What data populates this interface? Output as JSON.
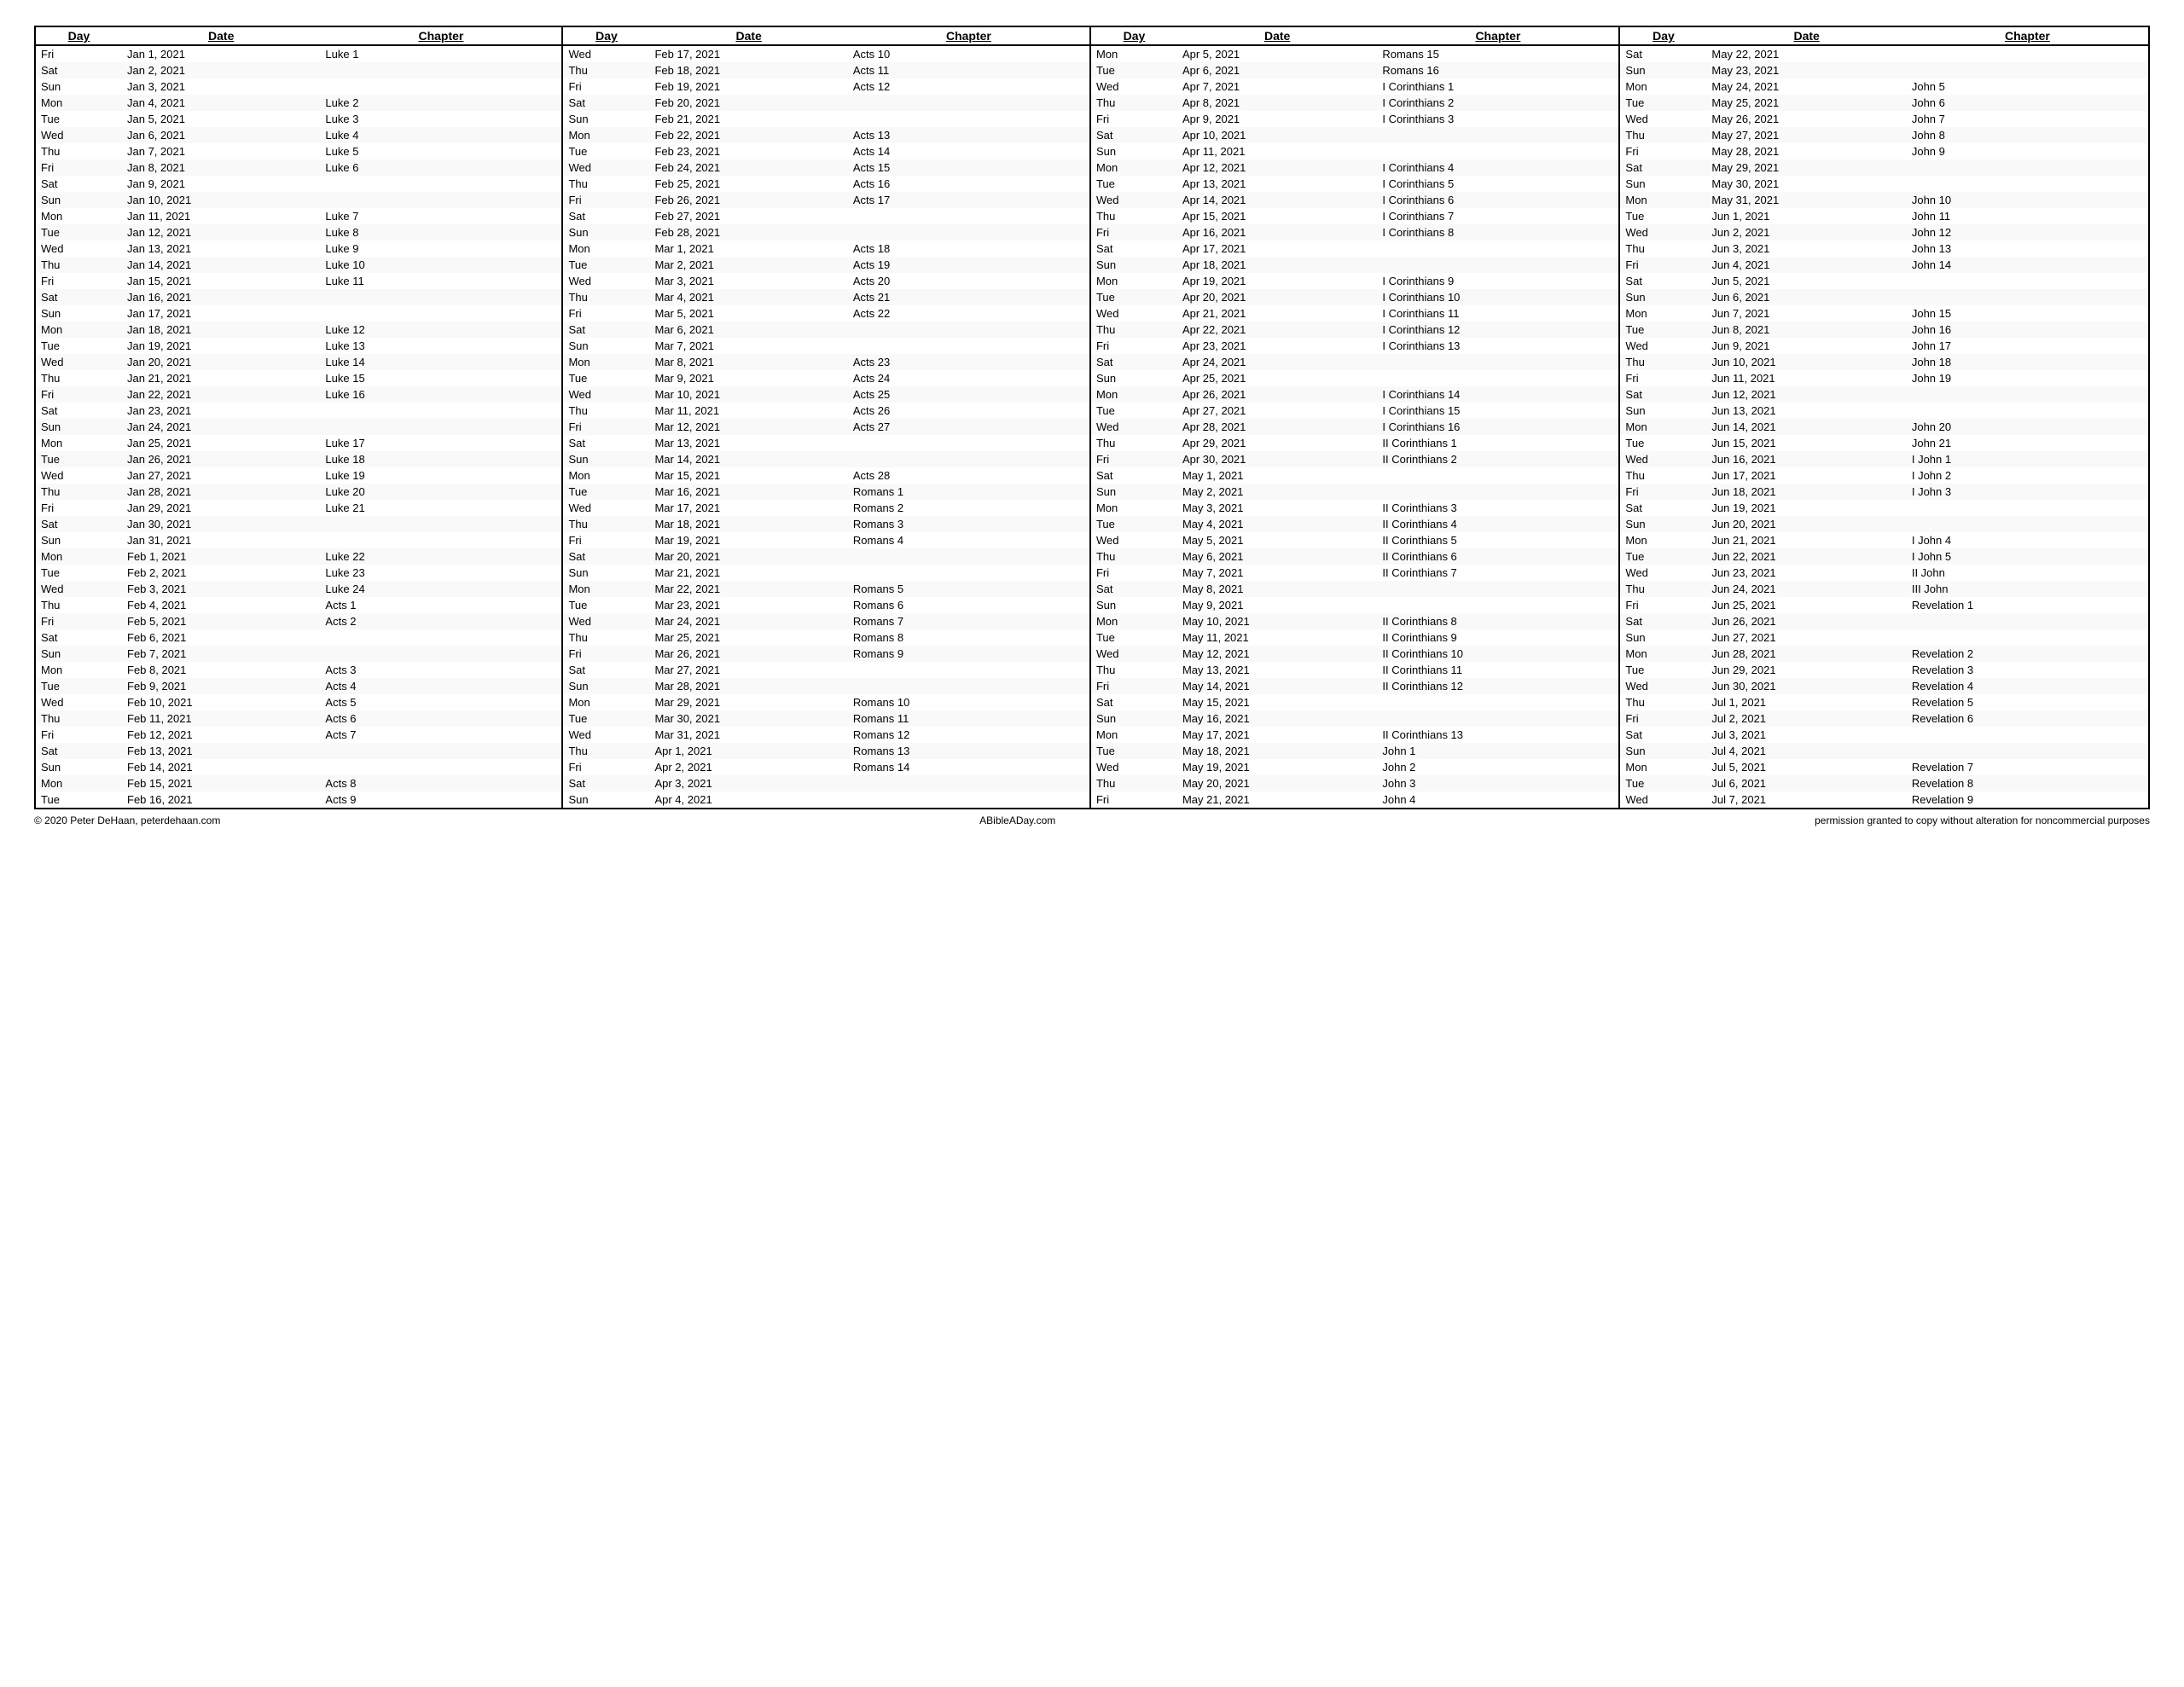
{
  "footer": {
    "copyright": "© 2020 Peter DeHaan, peterdehaan.com",
    "center": "ABibleADay.com",
    "right": "permission granted to copy without alteration for noncommercial purposes"
  },
  "columns": [
    "Day",
    "Date",
    "Chapter"
  ],
  "rows": [
    [
      "Fri",
      "Jan 1, 2021",
      "Luke 1",
      "Wed",
      "Feb 17, 2021",
      "Acts 10",
      "Mon",
      "Apr 5, 2021",
      "Romans 15",
      "Sat",
      "May 22, 2021",
      ""
    ],
    [
      "Sat",
      "Jan 2, 2021",
      "",
      "Thu",
      "Feb 18, 2021",
      "Acts 11",
      "Tue",
      "Apr 6, 2021",
      "Romans 16",
      "Sun",
      "May 23, 2021",
      ""
    ],
    [
      "Sun",
      "Jan 3, 2021",
      "",
      "Fri",
      "Feb 19, 2021",
      "Acts 12",
      "Wed",
      "Apr 7, 2021",
      "I Corinthians 1",
      "Mon",
      "May 24, 2021",
      "John 5"
    ],
    [
      "Mon",
      "Jan 4, 2021",
      "Luke 2",
      "Sat",
      "Feb 20, 2021",
      "",
      "Thu",
      "Apr 8, 2021",
      "I Corinthians 2",
      "Tue",
      "May 25, 2021",
      "John 6"
    ],
    [
      "Tue",
      "Jan 5, 2021",
      "Luke 3",
      "Sun",
      "Feb 21, 2021",
      "",
      "Fri",
      "Apr 9, 2021",
      "I Corinthians 3",
      "Wed",
      "May 26, 2021",
      "John 7"
    ],
    [
      "Wed",
      "Jan 6, 2021",
      "Luke 4",
      "Mon",
      "Feb 22, 2021",
      "Acts 13",
      "Sat",
      "Apr 10, 2021",
      "",
      "Thu",
      "May 27, 2021",
      "John 8"
    ],
    [
      "Thu",
      "Jan 7, 2021",
      "Luke 5",
      "Tue",
      "Feb 23, 2021",
      "Acts 14",
      "Sun",
      "Apr 11, 2021",
      "",
      "Fri",
      "May 28, 2021",
      "John 9"
    ],
    [
      "Fri",
      "Jan 8, 2021",
      "Luke 6",
      "Wed",
      "Feb 24, 2021",
      "Acts 15",
      "Mon",
      "Apr 12, 2021",
      "I Corinthians 4",
      "Sat",
      "May 29, 2021",
      ""
    ],
    [
      "Sat",
      "Jan 9, 2021",
      "",
      "Thu",
      "Feb 25, 2021",
      "Acts 16",
      "Tue",
      "Apr 13, 2021",
      "I Corinthians 5",
      "Sun",
      "May 30, 2021",
      ""
    ],
    [
      "Sun",
      "Jan 10, 2021",
      "",
      "Fri",
      "Feb 26, 2021",
      "Acts 17",
      "Wed",
      "Apr 14, 2021",
      "I Corinthians 6",
      "Mon",
      "May 31, 2021",
      "John 10"
    ],
    [
      "Mon",
      "Jan 11, 2021",
      "Luke 7",
      "Sat",
      "Feb 27, 2021",
      "",
      "Thu",
      "Apr 15, 2021",
      "I Corinthians 7",
      "Tue",
      "Jun 1, 2021",
      "John 11"
    ],
    [
      "Tue",
      "Jan 12, 2021",
      "Luke 8",
      "Sun",
      "Feb 28, 2021",
      "",
      "Fri",
      "Apr 16, 2021",
      "I Corinthians 8",
      "Wed",
      "Jun 2, 2021",
      "John 12"
    ],
    [
      "Wed",
      "Jan 13, 2021",
      "Luke 9",
      "Mon",
      "Mar 1, 2021",
      "Acts 18",
      "Sat",
      "Apr 17, 2021",
      "",
      "Thu",
      "Jun 3, 2021",
      "John 13"
    ],
    [
      "Thu",
      "Jan 14, 2021",
      "Luke 10",
      "Tue",
      "Mar 2, 2021",
      "Acts 19",
      "Sun",
      "Apr 18, 2021",
      "",
      "Fri",
      "Jun 4, 2021",
      "John 14"
    ],
    [
      "Fri",
      "Jan 15, 2021",
      "Luke 11",
      "Wed",
      "Mar 3, 2021",
      "Acts 20",
      "Mon",
      "Apr 19, 2021",
      "I Corinthians 9",
      "Sat",
      "Jun 5, 2021",
      ""
    ],
    [
      "Sat",
      "Jan 16, 2021",
      "",
      "Thu",
      "Mar 4, 2021",
      "Acts 21",
      "Tue",
      "Apr 20, 2021",
      "I Corinthians 10",
      "Sun",
      "Jun 6, 2021",
      ""
    ],
    [
      "Sun",
      "Jan 17, 2021",
      "",
      "Fri",
      "Mar 5, 2021",
      "Acts 22",
      "Wed",
      "Apr 21, 2021",
      "I Corinthians 11",
      "Mon",
      "Jun 7, 2021",
      "John 15"
    ],
    [
      "Mon",
      "Jan 18, 2021",
      "Luke 12",
      "Sat",
      "Mar 6, 2021",
      "",
      "Thu",
      "Apr 22, 2021",
      "I Corinthians 12",
      "Tue",
      "Jun 8, 2021",
      "John 16"
    ],
    [
      "Tue",
      "Jan 19, 2021",
      "Luke 13",
      "Sun",
      "Mar 7, 2021",
      "",
      "Fri",
      "Apr 23, 2021",
      "I Corinthians 13",
      "Wed",
      "Jun 9, 2021",
      "John 17"
    ],
    [
      "Wed",
      "Jan 20, 2021",
      "Luke 14",
      "Mon",
      "Mar 8, 2021",
      "Acts 23",
      "Sat",
      "Apr 24, 2021",
      "",
      "Thu",
      "Jun 10, 2021",
      "John 18"
    ],
    [
      "Thu",
      "Jan 21, 2021",
      "Luke 15",
      "Tue",
      "Mar 9, 2021",
      "Acts 24",
      "Sun",
      "Apr 25, 2021",
      "",
      "Fri",
      "Jun 11, 2021",
      "John 19"
    ],
    [
      "Fri",
      "Jan 22, 2021",
      "Luke 16",
      "Wed",
      "Mar 10, 2021",
      "Acts 25",
      "Mon",
      "Apr 26, 2021",
      "I Corinthians 14",
      "Sat",
      "Jun 12, 2021",
      ""
    ],
    [
      "Sat",
      "Jan 23, 2021",
      "",
      "Thu",
      "Mar 11, 2021",
      "Acts 26",
      "Tue",
      "Apr 27, 2021",
      "I Corinthians 15",
      "Sun",
      "Jun 13, 2021",
      ""
    ],
    [
      "Sun",
      "Jan 24, 2021",
      "",
      "Fri",
      "Mar 12, 2021",
      "Acts 27",
      "Wed",
      "Apr 28, 2021",
      "I Corinthians 16",
      "Mon",
      "Jun 14, 2021",
      "John 20"
    ],
    [
      "Mon",
      "Jan 25, 2021",
      "Luke 17",
      "Sat",
      "Mar 13, 2021",
      "",
      "Thu",
      "Apr 29, 2021",
      "II Corinthians 1",
      "Tue",
      "Jun 15, 2021",
      "John 21"
    ],
    [
      "Tue",
      "Jan 26, 2021",
      "Luke 18",
      "Sun",
      "Mar 14, 2021",
      "",
      "Fri",
      "Apr 30, 2021",
      "II Corinthians 2",
      "Wed",
      "Jun 16, 2021",
      "I John 1"
    ],
    [
      "Wed",
      "Jan 27, 2021",
      "Luke 19",
      "Mon",
      "Mar 15, 2021",
      "Acts 28",
      "Sat",
      "May 1, 2021",
      "",
      "Thu",
      "Jun 17, 2021",
      "I John 2"
    ],
    [
      "Thu",
      "Jan 28, 2021",
      "Luke 20",
      "Tue",
      "Mar 16, 2021",
      "Romans 1",
      "Sun",
      "May 2, 2021",
      "",
      "Fri",
      "Jun 18, 2021",
      "I John 3"
    ],
    [
      "Fri",
      "Jan 29, 2021",
      "Luke 21",
      "Wed",
      "Mar 17, 2021",
      "Romans 2",
      "Mon",
      "May 3, 2021",
      "II Corinthians 3",
      "Sat",
      "Jun 19, 2021",
      ""
    ],
    [
      "Sat",
      "Jan 30, 2021",
      "",
      "Thu",
      "Mar 18, 2021",
      "Romans 3",
      "Tue",
      "May 4, 2021",
      "II Corinthians 4",
      "Sun",
      "Jun 20, 2021",
      ""
    ],
    [
      "Sun",
      "Jan 31, 2021",
      "",
      "Fri",
      "Mar 19, 2021",
      "Romans 4",
      "Wed",
      "May 5, 2021",
      "II Corinthians 5",
      "Mon",
      "Jun 21, 2021",
      "I John 4"
    ],
    [
      "Mon",
      "Feb 1, 2021",
      "Luke 22",
      "Sat",
      "Mar 20, 2021",
      "",
      "Thu",
      "May 6, 2021",
      "II Corinthians 6",
      "Tue",
      "Jun 22, 2021",
      "I John 5"
    ],
    [
      "Tue",
      "Feb 2, 2021",
      "Luke 23",
      "Sun",
      "Mar 21, 2021",
      "",
      "Fri",
      "May 7, 2021",
      "II Corinthians 7",
      "Wed",
      "Jun 23, 2021",
      "II John"
    ],
    [
      "Wed",
      "Feb 3, 2021",
      "Luke 24",
      "Mon",
      "Mar 22, 2021",
      "Romans 5",
      "Sat",
      "May 8, 2021",
      "",
      "Thu",
      "Jun 24, 2021",
      "III John"
    ],
    [
      "Thu",
      "Feb 4, 2021",
      "Acts 1",
      "Tue",
      "Mar 23, 2021",
      "Romans 6",
      "Sun",
      "May 9, 2021",
      "",
      "Fri",
      "Jun 25, 2021",
      "Revelation 1"
    ],
    [
      "Fri",
      "Feb 5, 2021",
      "Acts 2",
      "Wed",
      "Mar 24, 2021",
      "Romans 7",
      "Mon",
      "May 10, 2021",
      "II Corinthians 8",
      "Sat",
      "Jun 26, 2021",
      ""
    ],
    [
      "Sat",
      "Feb 6, 2021",
      "",
      "Thu",
      "Mar 25, 2021",
      "Romans 8",
      "Tue",
      "May 11, 2021",
      "II Corinthians 9",
      "Sun",
      "Jun 27, 2021",
      ""
    ],
    [
      "Sun",
      "Feb 7, 2021",
      "",
      "Fri",
      "Mar 26, 2021",
      "Romans 9",
      "Wed",
      "May 12, 2021",
      "II Corinthians 10",
      "Mon",
      "Jun 28, 2021",
      "Revelation 2"
    ],
    [
      "Mon",
      "Feb 8, 2021",
      "Acts 3",
      "Sat",
      "Mar 27, 2021",
      "",
      "Thu",
      "May 13, 2021",
      "II Corinthians 11",
      "Tue",
      "Jun 29, 2021",
      "Revelation 3"
    ],
    [
      "Tue",
      "Feb 9, 2021",
      "Acts 4",
      "Sun",
      "Mar 28, 2021",
      "",
      "Fri",
      "May 14, 2021",
      "II Corinthians 12",
      "Wed",
      "Jun 30, 2021",
      "Revelation 4"
    ],
    [
      "Wed",
      "Feb 10, 2021",
      "Acts 5",
      "Mon",
      "Mar 29, 2021",
      "Romans 10",
      "Sat",
      "May 15, 2021",
      "",
      "Thu",
      "Jul 1, 2021",
      "Revelation 5"
    ],
    [
      "Thu",
      "Feb 11, 2021",
      "Acts 6",
      "Tue",
      "Mar 30, 2021",
      "Romans 11",
      "Sun",
      "May 16, 2021",
      "",
      "Fri",
      "Jul 2, 2021",
      "Revelation 6"
    ],
    [
      "Fri",
      "Feb 12, 2021",
      "Acts 7",
      "Wed",
      "Mar 31, 2021",
      "Romans 12",
      "Mon",
      "May 17, 2021",
      "II Corinthians 13",
      "Sat",
      "Jul 3, 2021",
      ""
    ],
    [
      "Sat",
      "Feb 13, 2021",
      "",
      "Thu",
      "Apr 1, 2021",
      "Romans 13",
      "Tue",
      "May 18, 2021",
      "John 1",
      "Sun",
      "Jul 4, 2021",
      ""
    ],
    [
      "Sun",
      "Feb 14, 2021",
      "",
      "Fri",
      "Apr 2, 2021",
      "Romans 14",
      "Wed",
      "May 19, 2021",
      "John 2",
      "Mon",
      "Jul 5, 2021",
      "Revelation 7"
    ],
    [
      "Mon",
      "Feb 15, 2021",
      "Acts 8",
      "Sat",
      "Apr 3, 2021",
      "",
      "Thu",
      "May 20, 2021",
      "John 3",
      "Tue",
      "Jul 6, 2021",
      "Revelation 8"
    ],
    [
      "Tue",
      "Feb 16, 2021",
      "Acts 9",
      "Sun",
      "Apr 4, 2021",
      "",
      "Fri",
      "May 21, 2021",
      "John 4",
      "Wed",
      "Jul 7, 2021",
      "Revelation 9"
    ]
  ]
}
